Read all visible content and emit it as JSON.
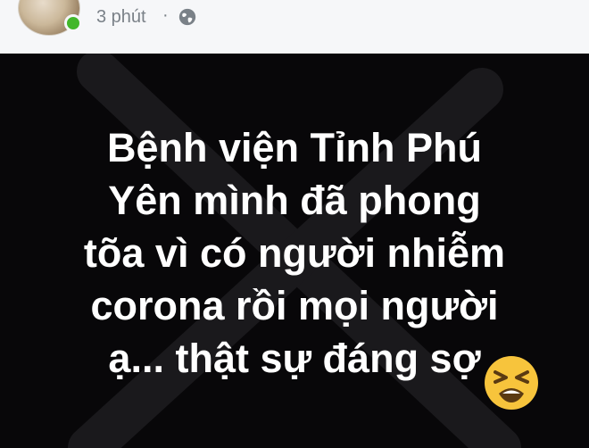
{
  "post": {
    "timestamp": "3 phút",
    "separator": "·",
    "privacy_icon": "globe-icon",
    "online_status_color": "#42b72a"
  },
  "image": {
    "background_color": "#080709",
    "text_lines": [
      "Bệnh viện Tỉnh Phú",
      "Yên mình đã phong",
      "tõa vì có người nhiễm",
      "corona rồi mọi người",
      "ạ... thật sự đáng sợ"
    ],
    "overlay_icon": "x-mark-overlay",
    "overlay_color": "#1a191c",
    "emoji": "tired-face-emoji"
  }
}
